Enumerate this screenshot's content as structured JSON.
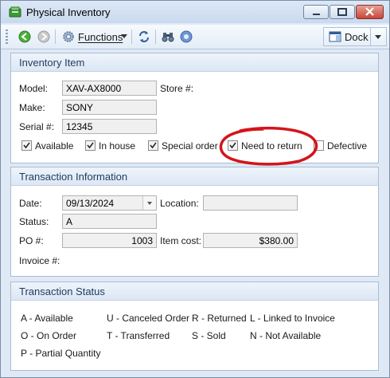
{
  "window": {
    "title": "Physical Inventory",
    "icon": "inventory-app-icon",
    "controls": [
      "minimize-icon",
      "maximize-icon",
      "close-icon"
    ]
  },
  "toolbar": {
    "back_icon": "back-arrow-icon",
    "forward_icon": "forward-arrow-icon",
    "functions_label": "Functions",
    "functions_icon": "gear-icon",
    "refresh_icon": "refresh-icon",
    "binoculars_icon": "binoculars-icon",
    "help_icon": "help-icon",
    "dock_label": "Dock",
    "dock_icon": "dock-window-icon"
  },
  "inventory_item": {
    "title": "Inventory Item",
    "model_label": "Model:",
    "model_value": "XAV-AX8000",
    "store_label": "Store #:",
    "make_label": "Make:",
    "make_value": "SONY",
    "serial_label": "Serial #:",
    "serial_value": "12345",
    "checkboxes": [
      {
        "label": "Available",
        "checked": true
      },
      {
        "label": "In house",
        "checked": true
      },
      {
        "label": "Special order",
        "checked": true
      },
      {
        "label": "Need to return",
        "checked": true
      },
      {
        "label": "Defective",
        "checked": false
      }
    ],
    "annotation_color": "#d4141a"
  },
  "transaction_info": {
    "title": "Transaction Information",
    "date_label": "Date:",
    "date_value": "09/13/2024",
    "location_label": "Location:",
    "location_value": "",
    "status_label": "Status:",
    "status_value": "A",
    "po_label": "PO #:",
    "po_value": "1003",
    "item_cost_label": "Item cost:",
    "item_cost_value": "$380.00",
    "invoice_label": "Invoice #:"
  },
  "transaction_status": {
    "title": "Transaction Status",
    "legend": [
      "A - Available",
      "U - Canceled Order",
      "R - Returned",
      "L - Linked to Invoice",
      "O - On Order",
      "T - Transferred",
      "S - Sold",
      "N - Not Available",
      "P - Partial Quantity"
    ]
  }
}
